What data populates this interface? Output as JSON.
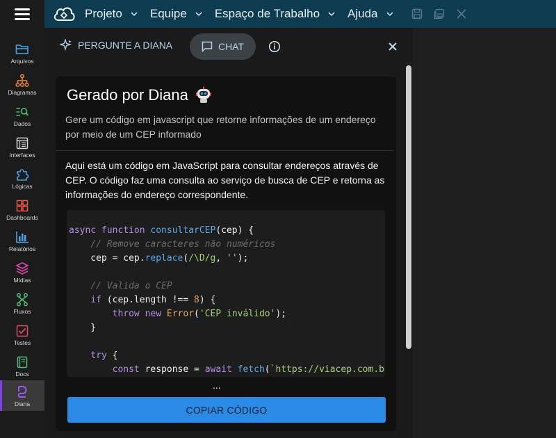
{
  "topbar": {
    "menu": [
      {
        "label": "Projeto"
      },
      {
        "label": "Equipe"
      },
      {
        "label": "Espaço de Trabalho"
      },
      {
        "label": "Ajuda"
      }
    ]
  },
  "sidebar": {
    "items": [
      {
        "label": "Arquivos",
        "icon": "folder-icon",
        "color": "#4aa3e8"
      },
      {
        "label": "Diagramas",
        "icon": "diagram-icon",
        "color": "#f08a3c"
      },
      {
        "label": "Dados",
        "icon": "data-search-icon",
        "color": "#4ec07a"
      },
      {
        "label": "Interfaces",
        "icon": "interface-icon",
        "color": "#d8d8d8"
      },
      {
        "label": "Lógicas",
        "icon": "puzzle-icon",
        "color": "#4aa3e8"
      },
      {
        "label": "Dashboards",
        "icon": "dashboard-icon",
        "color": "#e85a4a"
      },
      {
        "label": "Relatórios",
        "icon": "bar-chart-icon",
        "color": "#4aa3e8"
      },
      {
        "label": "Mídias",
        "icon": "layers-icon",
        "color": "#d84ab0"
      },
      {
        "label": "Fluxos",
        "icon": "flow-icon",
        "color": "#4ec07a"
      },
      {
        "label": "Testes",
        "icon": "checklist-icon",
        "color": "#e84a6a"
      },
      {
        "label": "Docs",
        "icon": "book-icon",
        "color": "#4ec07a"
      },
      {
        "label": "Diana",
        "icon": "diana-icon",
        "color": "#8a4ae8"
      }
    ]
  },
  "panel": {
    "ask_label": "PERGUNTE A DIANA",
    "chat_label": "CHAT",
    "card": {
      "title": "Gerado por Diana",
      "prompt": "Gere um código em javascript que retorne informações de um endereço por meio de um CEP informado",
      "answer": "Aqui está um código em JavaScript para consultar endereços através de CEP. O código faz uma consulta ao serviço de busca de CEP e retorna as informações do endereço correspondente.",
      "ellipsis": "...",
      "copy_label": "COPIAR CÓDIGO"
    }
  },
  "colors": {
    "topbar": "#0d3b4f",
    "accent": "#2b8ae6",
    "active_indicator": "#7b3fe4"
  }
}
